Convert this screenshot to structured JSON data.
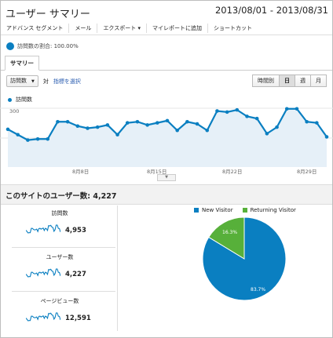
{
  "header": {
    "title": "ユーザー サマリー",
    "date_range": "2013/08/01 - 2013/08/31"
  },
  "toolbar": {
    "items": [
      "アドバンス セグメント",
      "メール",
      "エクスポート ▾",
      "マイレポートに追加",
      "ショートカット"
    ]
  },
  "segment": {
    "visits_pct_label": "訪問数の割合: 100.00%"
  },
  "tabs": {
    "summary": "サマリー"
  },
  "controls": {
    "metric_select": "訪問数",
    "vs_label": "対",
    "select_metric_link": "指標を選択"
  },
  "granularity": {
    "hourly": "時間別",
    "day": "日",
    "week": "週",
    "month": "月",
    "active": "日"
  },
  "chart_legend": {
    "series_name": "訪問数"
  },
  "chart_data": {
    "type": "area",
    "series": [
      {
        "name": "訪問数",
        "color": "#0a7fc1",
        "values": [
          175,
          150,
          125,
          130,
          130,
          210,
          210,
          190,
          180,
          185,
          195,
          150,
          205,
          210,
          195,
          205,
          215,
          170,
          210,
          200,
          170,
          260,
          255,
          265,
          235,
          225,
          155,
          185,
          270,
          270,
          210,
          205,
          140
        ]
      }
    ],
    "x_tick_labels": [
      "8月8日",
      "8月15日",
      "8月22日",
      "8月29日"
    ],
    "y_tick_labels": [
      "300",
      "150"
    ],
    "ylim": [
      0,
      320
    ]
  },
  "section": {
    "title": "このサイトのユーザー数: 4,227"
  },
  "metrics": [
    {
      "label": "訪問数",
      "value": "4,953"
    },
    {
      "label": "ユーザー数",
      "value": "4,227"
    },
    {
      "label": "ページビュー数",
      "value": "12,591"
    }
  ],
  "pie": {
    "legend": [
      {
        "name": "New Visitor",
        "color": "#0a7fc1"
      },
      {
        "name": "Returning Visitor",
        "color": "#57b03a"
      }
    ],
    "values": [
      83.7,
      16.3
    ],
    "labels": [
      "83.7%",
      "16.3%"
    ]
  }
}
